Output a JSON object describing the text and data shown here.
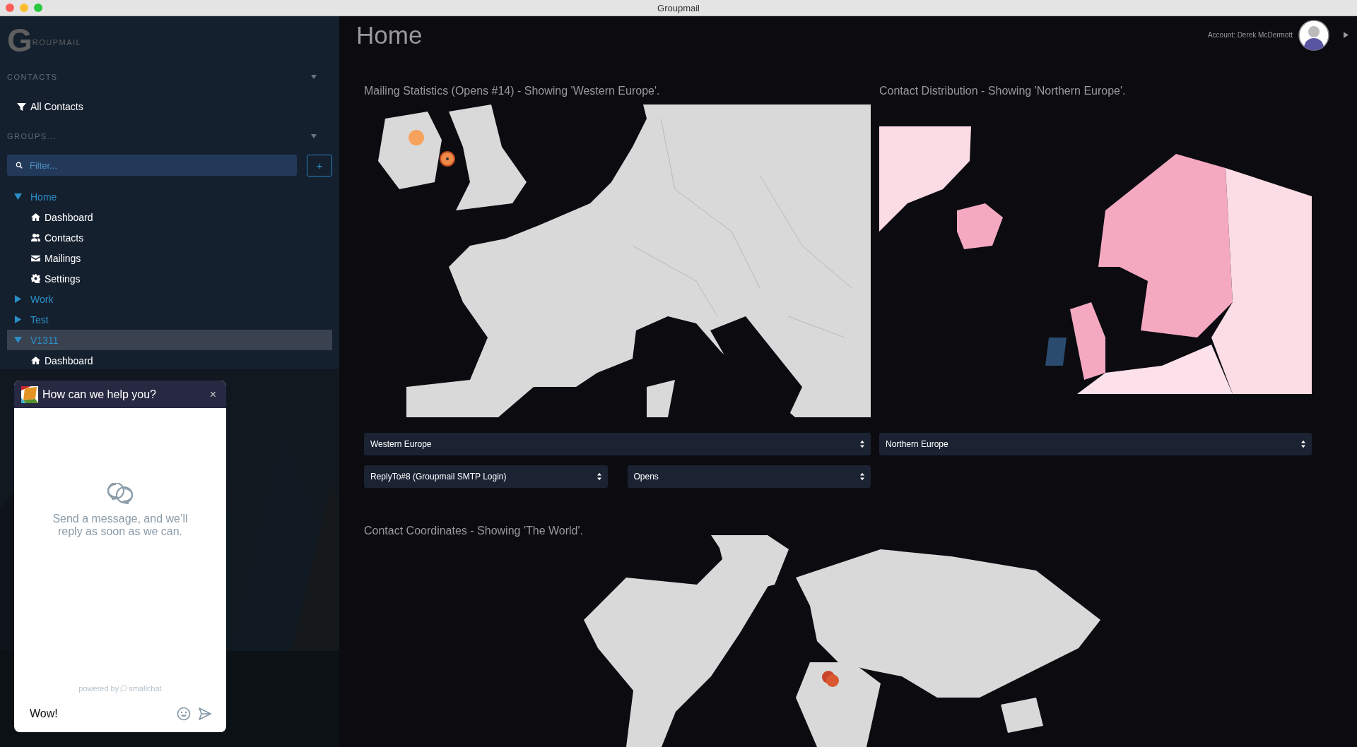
{
  "window": {
    "title": "Groupmail"
  },
  "sidebar": {
    "logo": {
      "initial": "G",
      "rest": "ROUPMAIL"
    },
    "contacts_header": "CONTACTS",
    "contact_filters": [
      {
        "label": "All Contacts",
        "selected": false
      }
    ],
    "groups_header": "GROUPS...",
    "filter": {
      "placeholder": "Filter..."
    },
    "add_button": "+",
    "tree": [
      {
        "label": "Home",
        "expanded": true,
        "selected": false,
        "children": [
          {
            "label": "Dashboard",
            "kind": "home"
          },
          {
            "label": "Contacts",
            "kind": "contacts"
          },
          {
            "label": "Mailings",
            "kind": "mail"
          },
          {
            "label": "Settings",
            "kind": "settings"
          }
        ]
      },
      {
        "label": "Work",
        "expanded": false,
        "selected": false
      },
      {
        "label": "Test",
        "expanded": false,
        "selected": false
      },
      {
        "label": "V1311",
        "expanded": true,
        "selected": true,
        "children": [
          {
            "label": "Dashboard",
            "kind": "home"
          }
        ]
      }
    ]
  },
  "chat": {
    "title": "How can we help you?",
    "close": "×",
    "message": "Send a message, and we’ll reply as soon as we can.",
    "powered_by": "powered by",
    "brand": "smallchat",
    "input": {
      "value": "Wow!"
    }
  },
  "header": {
    "title": "Home",
    "account": "Account: Derek McDermott"
  },
  "panels": [
    {
      "kind": "markers",
      "title": "Mailing Statistics (Opens #14) - Showing 'Western Europe'.",
      "selects": [
        [
          "Western Europe"
        ],
        [
          "ReplyTo#8 (Groupmail SMTP Login)",
          "Opens"
        ]
      ]
    },
    {
      "kind": "choropleth",
      "title": "Contact Distribution - Showing 'Northern Europe'.",
      "selects": [
        [
          "Northern Europe"
        ]
      ]
    }
  ],
  "world": {
    "title": "Contact Coordinates - Showing 'The World'."
  }
}
